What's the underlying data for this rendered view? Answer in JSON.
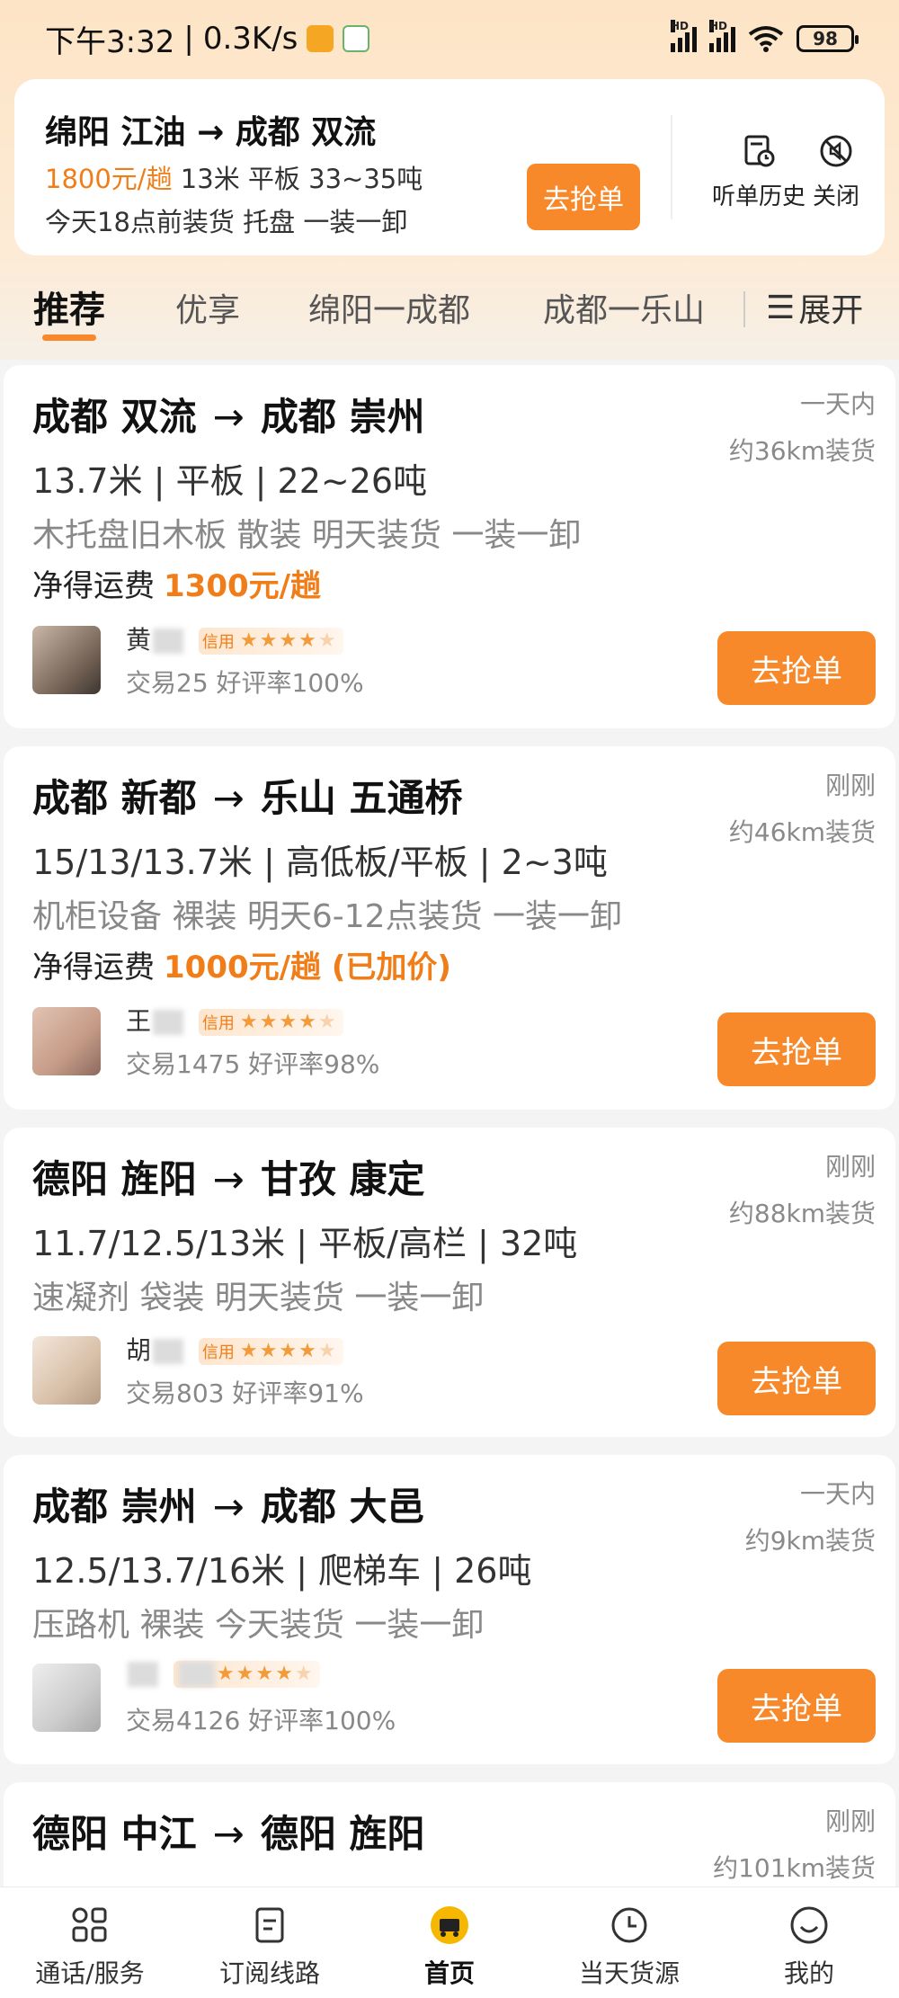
{
  "status_bar": {
    "time": "下午3:32",
    "net_speed": "0.3K/s",
    "battery": "98"
  },
  "listen_card": {
    "route": "绵阳 江油 → 成都 双流",
    "price": "1800元/趟",
    "spec": "13米 平板 33~35吨",
    "detail": "今天18点前装货 托盘 一装一卸",
    "grab_label": "去抢单",
    "history_label": "听单历史",
    "close_label": "关闭"
  },
  "tabs": {
    "items": [
      "推荐",
      "优享",
      "绵阳一成都",
      "成都一乐山"
    ],
    "expand_label": "展开"
  },
  "cards": [
    {
      "from": "成都 双流",
      "to": "成都 崇州",
      "time": "一天内",
      "distance": "约36km装货",
      "spec": "13.7米 | 平板 | 22~26吨",
      "goods": "木托盘旧木板 散装 明天装货 一装一卸",
      "fee_label": "净得运费",
      "fee": "1300元/趟",
      "owner": "黄",
      "stats": "交易25 好评率100%",
      "grab_label": "去抢单"
    },
    {
      "from": "成都 新都",
      "to": "乐山 五通桥",
      "time": "刚刚",
      "distance": "约46km装货",
      "spec": "15/13/13.7米 | 高低板/平板 | 2~3吨",
      "goods": "机柜设备 裸装 明天6-12点装货 一装一卸",
      "fee_label": "净得运费",
      "fee": "1000元/趟 (已加价)",
      "owner": "王",
      "stats": "交易1475 好评率98%",
      "grab_label": "去抢单"
    },
    {
      "from": "德阳 旌阳",
      "to": "甘孜 康定",
      "time": "刚刚",
      "distance": "约88km装货",
      "spec": "11.7/12.5/13米 | 平板/高栏 | 32吨",
      "goods": "速凝剂 袋装 明天装货 一装一卸",
      "owner": "胡",
      "stats": "交易803 好评率91%",
      "grab_label": "去抢单"
    },
    {
      "from": "成都 崇州",
      "to": "成都 大邑",
      "time": "一天内",
      "distance": "约9km装货",
      "spec": "12.5/13.7/16米 | 爬梯车 | 26吨",
      "goods": "压路机 裸装 今天装货 一装一卸",
      "owner": "",
      "stats": "交易4126 好评率100%",
      "grab_label": "去抢单"
    },
    {
      "from": "德阳 中江",
      "to": "德阳 旌阳",
      "time": "刚刚",
      "distance": "约101km装货"
    }
  ],
  "credit_label": "信用",
  "nav": {
    "items": [
      "通话/服务",
      "订阅线路",
      "首页",
      "当天货源",
      "我的"
    ]
  }
}
